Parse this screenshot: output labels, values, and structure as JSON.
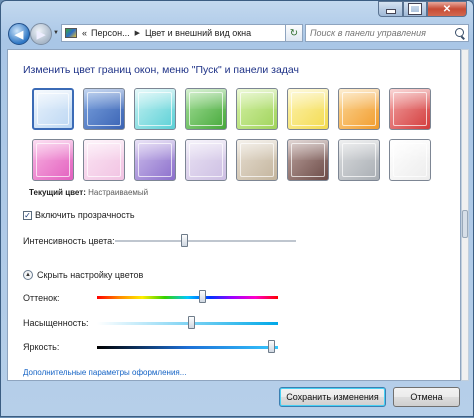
{
  "window": {
    "caption": {
      "minimize": "",
      "maximize": "",
      "close": "✕"
    }
  },
  "nav": {
    "back_arrow": "◀",
    "forward_arrow": "▶",
    "history_dropdown": "▼",
    "breadcrumb": [
      "«",
      "Персон...",
      "Цвет и внешний вид окна"
    ],
    "breadcrumb_separator": "▶",
    "address_dropdown": "▼",
    "refresh": "↻",
    "search_placeholder": "Поиск в панели управления"
  },
  "main": {
    "heading": "Изменить цвет границ окон, меню \"Пуск\" и панели задач",
    "swatches": [
      {
        "name": "sky",
        "colors": [
          "#eaf3fc",
          "#bcd7f3"
        ]
      },
      {
        "name": "twilight",
        "colors": [
          "#7da4df",
          "#3a63b4"
        ]
      },
      {
        "name": "sea",
        "colors": [
          "#c8f2f3",
          "#5ad0d6"
        ]
      },
      {
        "name": "leaf",
        "colors": [
          "#a7e09b",
          "#45a83a"
        ]
      },
      {
        "name": "lime",
        "colors": [
          "#d7f2a9",
          "#9fd35a"
        ]
      },
      {
        "name": "sun",
        "colors": [
          "#fdf3b2",
          "#f3db4f"
        ]
      },
      {
        "name": "pumpkin",
        "colors": [
          "#fbd99b",
          "#f29b2b"
        ]
      },
      {
        "name": "ruby",
        "colors": [
          "#f3a5a5",
          "#d23a3a"
        ]
      },
      {
        "name": "fuchsia",
        "colors": [
          "#f8b5e2",
          "#e35fbf"
        ]
      },
      {
        "name": "blush",
        "colors": [
          "#fbe6f4",
          "#f1c2e2"
        ]
      },
      {
        "name": "violet",
        "colors": [
          "#cfc0ec",
          "#8b6fcc"
        ]
      },
      {
        "name": "lavender",
        "colors": [
          "#eae3f4",
          "#cdbfe3"
        ]
      },
      {
        "name": "taupe",
        "colors": [
          "#e8e0d3",
          "#c3b49d"
        ]
      },
      {
        "name": "chocolate",
        "colors": [
          "#bda4a0",
          "#6c4b47"
        ]
      },
      {
        "name": "slate",
        "colors": [
          "#dbdddf",
          "#a8adb3"
        ]
      },
      {
        "name": "frost",
        "colors": [
          "#ffffff",
          "#ececec"
        ]
      }
    ],
    "selected_swatch_index": 0,
    "current_color_label": "Текущий цвет:",
    "current_color_value": "Настраиваемый",
    "transparency_label": "Включить прозрачность",
    "transparency_checked": true,
    "check_glyph": "✓",
    "intensity_label": "Интенсивность цвета:",
    "intensity_level": 0.38,
    "collapse_glyph": "▲",
    "hide_mixer_label": "Скрыть настройку цветов",
    "hue_label": "Оттенок:",
    "hue_level": 0.58,
    "saturation_label": "Насыщенность:",
    "saturation_level": 0.52,
    "brightness_label": "Яркость:",
    "brightness_level": 0.96,
    "advanced_link": "Дополнительные параметры оформления..."
  },
  "footer": {
    "save_label": "Сохранить изменения",
    "cancel_label": "Отмена"
  }
}
